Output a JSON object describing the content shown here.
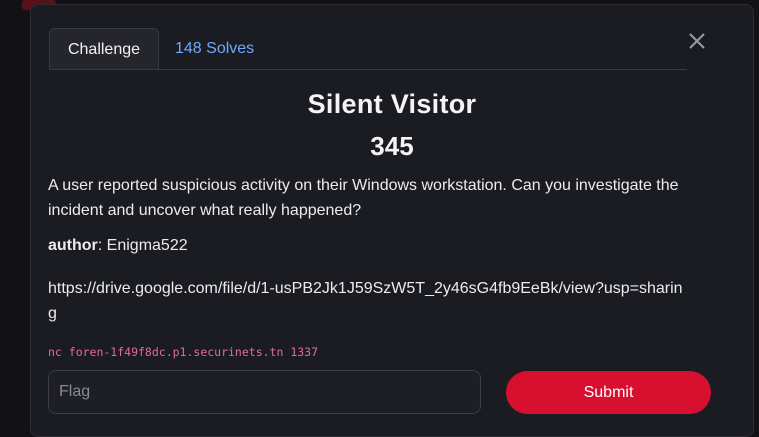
{
  "tabs": {
    "challenge": "Challenge",
    "solves": "148 Solves"
  },
  "challenge": {
    "name": "Silent Visitor",
    "value": "345",
    "description": "A user reported suspicious activity on their Windows workstation. Can you investigate the incident and uncover what really happened?",
    "author_label": "author",
    "author_name": ": Enigma522",
    "link": "https://drive.google.com/file/d/1-usPB2Jk1J59SzW5T_2y46sG4fb9EeBk/view?usp=sharing",
    "connection": "nc foren-1f49f8dc.p1.securinets.tn 1337"
  },
  "form": {
    "flag_placeholder": "Flag",
    "submit_label": "Submit"
  },
  "colors": {
    "accent": "#d6102e",
    "link_tab": "#6ea8fe",
    "code": "#e06c9f"
  },
  "icons": {
    "close": "close-icon"
  }
}
